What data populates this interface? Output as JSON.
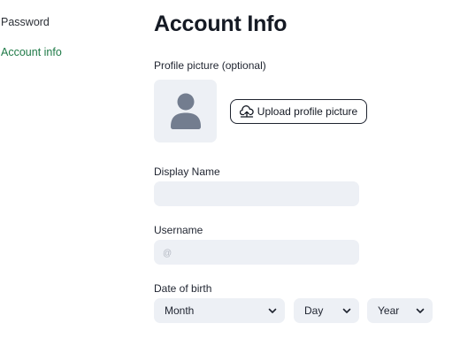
{
  "sidebar": {
    "items": [
      {
        "label": "Password",
        "active": false
      },
      {
        "label": "Account info",
        "active": true
      }
    ]
  },
  "main": {
    "title": "Account Info",
    "profile_picture": {
      "label": "Profile picture (optional)",
      "upload_label": "Upload profile picture",
      "avatar_icon": "user-icon",
      "upload_icon": "upload-icon"
    },
    "display_name": {
      "label": "Display Name",
      "value": "",
      "placeholder": ""
    },
    "username": {
      "label": "Username",
      "value": "",
      "placeholder": "@"
    },
    "date_of_birth": {
      "label": "Date of birth",
      "month": "Month",
      "day": "Day",
      "year": "Year",
      "chevron_icon": "chevron-down-icon"
    }
  },
  "colors": {
    "accent": "#1f7a47",
    "field_bg": "#edf0f5",
    "avatar_icon": "#737d8f",
    "text": "#1f2430"
  }
}
